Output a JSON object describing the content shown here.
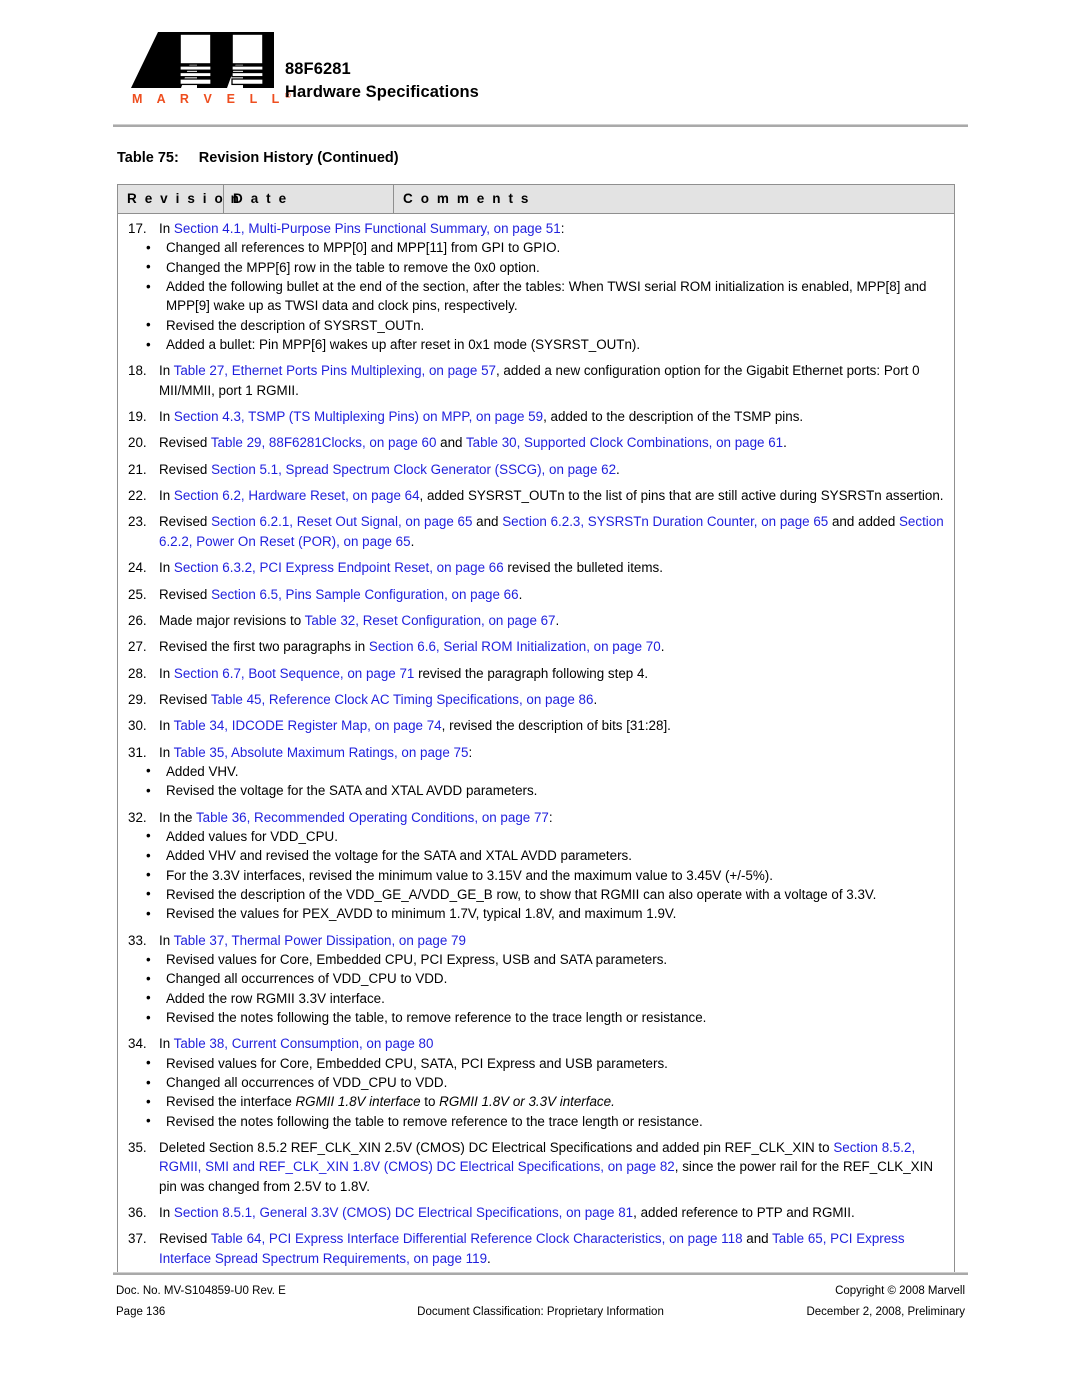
{
  "header": {
    "logo_wordmark": "M A R V E L L",
    "logo_registered": "®",
    "product": "88F6281",
    "subtitle": "Hardware Specifications"
  },
  "table": {
    "caption_number": "Table 75:",
    "caption_title": "Revision History (Continued)",
    "columns": [
      "R e v i s i o n",
      "D a t e",
      "C o m m e n t s"
    ],
    "entries": [
      {
        "num": "17.",
        "parts": [
          {
            "t": "In ",
            "s": "plain"
          },
          {
            "t": "Section 4.1, Multi-Purpose Pins Functional Summary, on page 51",
            "s": "link"
          },
          {
            "t": ":",
            "s": "plain"
          }
        ],
        "bullets": [
          [
            {
              "t": "Changed all references to MPP[0] and MPP[11] from GPI to GPIO.",
              "s": "plain"
            }
          ],
          [
            {
              "t": "Changed the MPP[6] row in the table to remove the 0x0 option.",
              "s": "plain"
            }
          ],
          [
            {
              "t": "Added the following bullet at the end of the section, after the tables: When TWSI serial ROM initialization is enabled, MPP[8] and MPP[9] wake up as TWSI data and clock pins, respectively.",
              "s": "plain"
            }
          ],
          [
            {
              "t": "Revised the description of SYSRST_OUTn.",
              "s": "plain"
            }
          ],
          [
            {
              "t": "Added a bullet: Pin MPP[6] wakes up after reset in 0x1 mode (SYSRST_OUTn).",
              "s": "plain"
            }
          ]
        ]
      },
      {
        "num": "18.",
        "parts": [
          {
            "t": "In ",
            "s": "plain"
          },
          {
            "t": "Table 27, Ethernet Ports Pins Multiplexing, on page 57",
            "s": "link"
          },
          {
            "t": ", added a new configuration option for the Gigabit Ethernet ports: Port 0 MII/MMII, port 1 RGMII.",
            "s": "plain"
          }
        ],
        "bullets": []
      },
      {
        "num": "19.",
        "parts": [
          {
            "t": "In ",
            "s": "plain"
          },
          {
            "t": "Section 4.3, TSMP (TS Multiplexing Pins) on MPP, on page 59",
            "s": "link"
          },
          {
            "t": ", added to the description of the TSMP pins.",
            "s": "plain"
          }
        ],
        "bullets": []
      },
      {
        "num": "20.",
        "parts": [
          {
            "t": "Revised ",
            "s": "plain"
          },
          {
            "t": "Table 29, 88F6281Clocks, on page 60",
            "s": "link"
          },
          {
            "t": " and ",
            "s": "plain"
          },
          {
            "t": "Table 30, Supported Clock Combinations, on page 61",
            "s": "link"
          },
          {
            "t": ".",
            "s": "plain"
          }
        ],
        "bullets": []
      },
      {
        "num": "21.",
        "parts": [
          {
            "t": "Revised ",
            "s": "plain"
          },
          {
            "t": "Section 5.1, Spread Spectrum Clock Generator (SSCG), on page 62",
            "s": "link"
          },
          {
            "t": ".",
            "s": "plain"
          }
        ],
        "bullets": []
      },
      {
        "num": "22.",
        "parts": [
          {
            "t": "In ",
            "s": "plain"
          },
          {
            "t": "Section 6.2, Hardware Reset, on page 64",
            "s": "link"
          },
          {
            "t": ", added SYSRST_OUTn to the list of pins that are still active during SYSRSTn assertion.",
            "s": "plain"
          }
        ],
        "bullets": []
      },
      {
        "num": "23.",
        "parts": [
          {
            "t": "Revised ",
            "s": "plain"
          },
          {
            "t": "Section 6.2.1, Reset Out Signal, on page 65",
            "s": "link"
          },
          {
            "t": " and ",
            "s": "plain"
          },
          {
            "t": "Section 6.2.3, SYSRSTn Duration Counter, on page 65",
            "s": "link"
          },
          {
            "t": " and added ",
            "s": "plain"
          },
          {
            "t": "Section 6.2.2, Power On Reset (POR), on page 65",
            "s": "link"
          },
          {
            "t": ".",
            "s": "plain"
          }
        ],
        "bullets": []
      },
      {
        "num": "24.",
        "parts": [
          {
            "t": "In ",
            "s": "plain"
          },
          {
            "t": "Section 6.3.2, PCI Express Endpoint Reset, on page 66",
            "s": "link"
          },
          {
            "t": " revised the bulleted items.",
            "s": "plain"
          }
        ],
        "bullets": []
      },
      {
        "num": "25.",
        "parts": [
          {
            "t": "Revised ",
            "s": "plain"
          },
          {
            "t": "Section 6.5, Pins Sample Configuration, on page 66",
            "s": "link"
          },
          {
            "t": ".",
            "s": "plain"
          }
        ],
        "bullets": []
      },
      {
        "num": "26.",
        "parts": [
          {
            "t": "Made major revisions to ",
            "s": "plain"
          },
          {
            "t": "Table 32, Reset Configuration, on page 67",
            "s": "link"
          },
          {
            "t": ".",
            "s": "plain"
          }
        ],
        "bullets": []
      },
      {
        "num": "27.",
        "parts": [
          {
            "t": "Revised the first two paragraphs in ",
            "s": "plain"
          },
          {
            "t": "Section 6.6, Serial ROM Initialization, on page 70",
            "s": "link"
          },
          {
            "t": ".",
            "s": "plain"
          }
        ],
        "bullets": []
      },
      {
        "num": "28.",
        "parts": [
          {
            "t": "In ",
            "s": "plain"
          },
          {
            "t": "Section 6.7, Boot Sequence, on page 71",
            "s": "link"
          },
          {
            "t": " revised the paragraph following step 4.",
            "s": "plain"
          }
        ],
        "bullets": []
      },
      {
        "num": "29.",
        "parts": [
          {
            "t": "Revised ",
            "s": "plain"
          },
          {
            "t": "Table 45, Reference Clock AC Timing Specifications, on page 86",
            "s": "link"
          },
          {
            "t": ".",
            "s": "plain"
          }
        ],
        "bullets": []
      },
      {
        "num": "30.",
        "parts": [
          {
            "t": "In ",
            "s": "plain"
          },
          {
            "t": "Table 34, IDCODE Register Map, on page 74",
            "s": "link"
          },
          {
            "t": ", revised the description of bits [31:28].",
            "s": "plain"
          }
        ],
        "bullets": []
      },
      {
        "num": "31.",
        "parts": [
          {
            "t": "In ",
            "s": "plain"
          },
          {
            "t": "Table 35, Absolute Maximum Ratings, on page 75",
            "s": "link"
          },
          {
            "t": ":",
            "s": "plain"
          }
        ],
        "bullets": [
          [
            {
              "t": "Added VHV.",
              "s": "plain"
            }
          ],
          [
            {
              "t": "Revised the voltage for the SATA and XTAL AVDD parameters.",
              "s": "plain"
            }
          ]
        ]
      },
      {
        "num": "32.",
        "parts": [
          {
            "t": "In the ",
            "s": "plain"
          },
          {
            "t": "Table 36, Recommended Operating Conditions, on page 77",
            "s": "link"
          },
          {
            "t": ":",
            "s": "plain"
          }
        ],
        "bullets": [
          [
            {
              "t": "Added values for VDD_CPU.",
              "s": "plain"
            }
          ],
          [
            {
              "t": "Added VHV and revised the voltage for the SATA and XTAL AVDD parameters.",
              "s": "plain"
            }
          ],
          [
            {
              "t": "For the 3.3V interfaces, revised the minimum value to 3.15V and the maximum value to 3.45V (+/-5%).",
              "s": "plain"
            }
          ],
          [
            {
              "t": "Revised the description of the VDD_GE_A/VDD_GE_B row, to show that RGMII can also operate with a voltage of 3.3V.",
              "s": "plain"
            }
          ],
          [
            {
              "t": "Revised the values for PEX_AVDD to minimum 1.7V, typical 1.8V, and maximum 1.9V.",
              "s": "plain"
            }
          ]
        ]
      },
      {
        "num": "33.",
        "parts": [
          {
            "t": "In ",
            "s": "plain"
          },
          {
            "t": "Table 37, Thermal Power Dissipation, on page 79",
            "s": "link"
          }
        ],
        "bullets": [
          [
            {
              "t": "Revised values for Core, Embedded CPU, PCI Express, USB and SATA parameters.",
              "s": "plain"
            }
          ],
          [
            {
              "t": "Changed all occurrences of VDD_CPU to VDD.",
              "s": "plain"
            }
          ],
          [
            {
              "t": "Added the row RGMII 3.3V interface.",
              "s": "plain"
            }
          ],
          [
            {
              "t": "Revised the notes following the table, to remove reference to the trace length or resistance.",
              "s": "plain"
            }
          ]
        ]
      },
      {
        "num": "34.",
        "parts": [
          {
            "t": "In ",
            "s": "plain"
          },
          {
            "t": "Table 38, Current Consumption, on page 80",
            "s": "link"
          }
        ],
        "bullets": [
          [
            {
              "t": "Revised values for Core, Embedded CPU, SATA, PCI Express and USB parameters.",
              "s": "plain"
            }
          ],
          [
            {
              "t": "Changed all occurrences of VDD_CPU to VDD.",
              "s": "plain"
            }
          ],
          [
            {
              "t": "Revised the interface ",
              "s": "plain"
            },
            {
              "t": "RGMII 1.8V interface",
              "s": "italic"
            },
            {
              "t": " to ",
              "s": "plain"
            },
            {
              "t": "RGMII 1.8V or 3.3V interface.",
              "s": "italic"
            }
          ],
          [
            {
              "t": "Revised the notes following the table to remove reference to the trace length or resistance.",
              "s": "plain"
            }
          ]
        ]
      },
      {
        "num": "35.",
        "parts": [
          {
            "t": "Deleted Section 8.5.2 REF_CLK_XIN 2.5V (CMOS) DC Electrical Specifications and added pin REF_CLK_XIN to ",
            "s": "plain"
          },
          {
            "t": "Section 8.5.2, RGMII, SMI and REF_CLK_XIN 1.8V (CMOS) DC Electrical Specifications, on page 82",
            "s": "link"
          },
          {
            "t": ", since the power rail for the REF_CLK_XIN pin was changed from 2.5V to 1.8V.",
            "s": "plain"
          }
        ],
        "bullets": []
      },
      {
        "num": "36.",
        "parts": [
          {
            "t": "In ",
            "s": "plain"
          },
          {
            "t": "Section 8.5.1, General 3.3V (CMOS) DC Electrical Specifications, on page 81",
            "s": "link"
          },
          {
            "t": ", added reference to PTP and RGMII.",
            "s": "plain"
          }
        ],
        "bullets": []
      },
      {
        "num": "37.",
        "parts": [
          {
            "t": "Revised ",
            "s": "plain"
          },
          {
            "t": "Table 64, PCI Express Interface Differential Reference Clock Characteristics, on page 118",
            "s": "link"
          },
          {
            "t": " and ",
            "s": "plain"
          },
          {
            "t": "Table 65, PCI Express Interface Spread Spectrum Requirements, on page 119",
            "s": "link"
          },
          {
            "t": ".",
            "s": "plain"
          }
        ],
        "bullets": []
      }
    ]
  },
  "footer": {
    "doc_no": "Doc. No. MV-S104859-U0 Rev. E",
    "copyright": "Copyright © 2008 Marvell",
    "page": "Page 136",
    "classification": "Document Classification: Proprietary Information",
    "date": "December 2, 2008, Preliminary"
  },
  "colors": {
    "link": "#1f1fdd",
    "brand_orange": "#EE4E1F",
    "table_header_bg": "#e3e3e3",
    "rule": "#a9a9a9"
  }
}
